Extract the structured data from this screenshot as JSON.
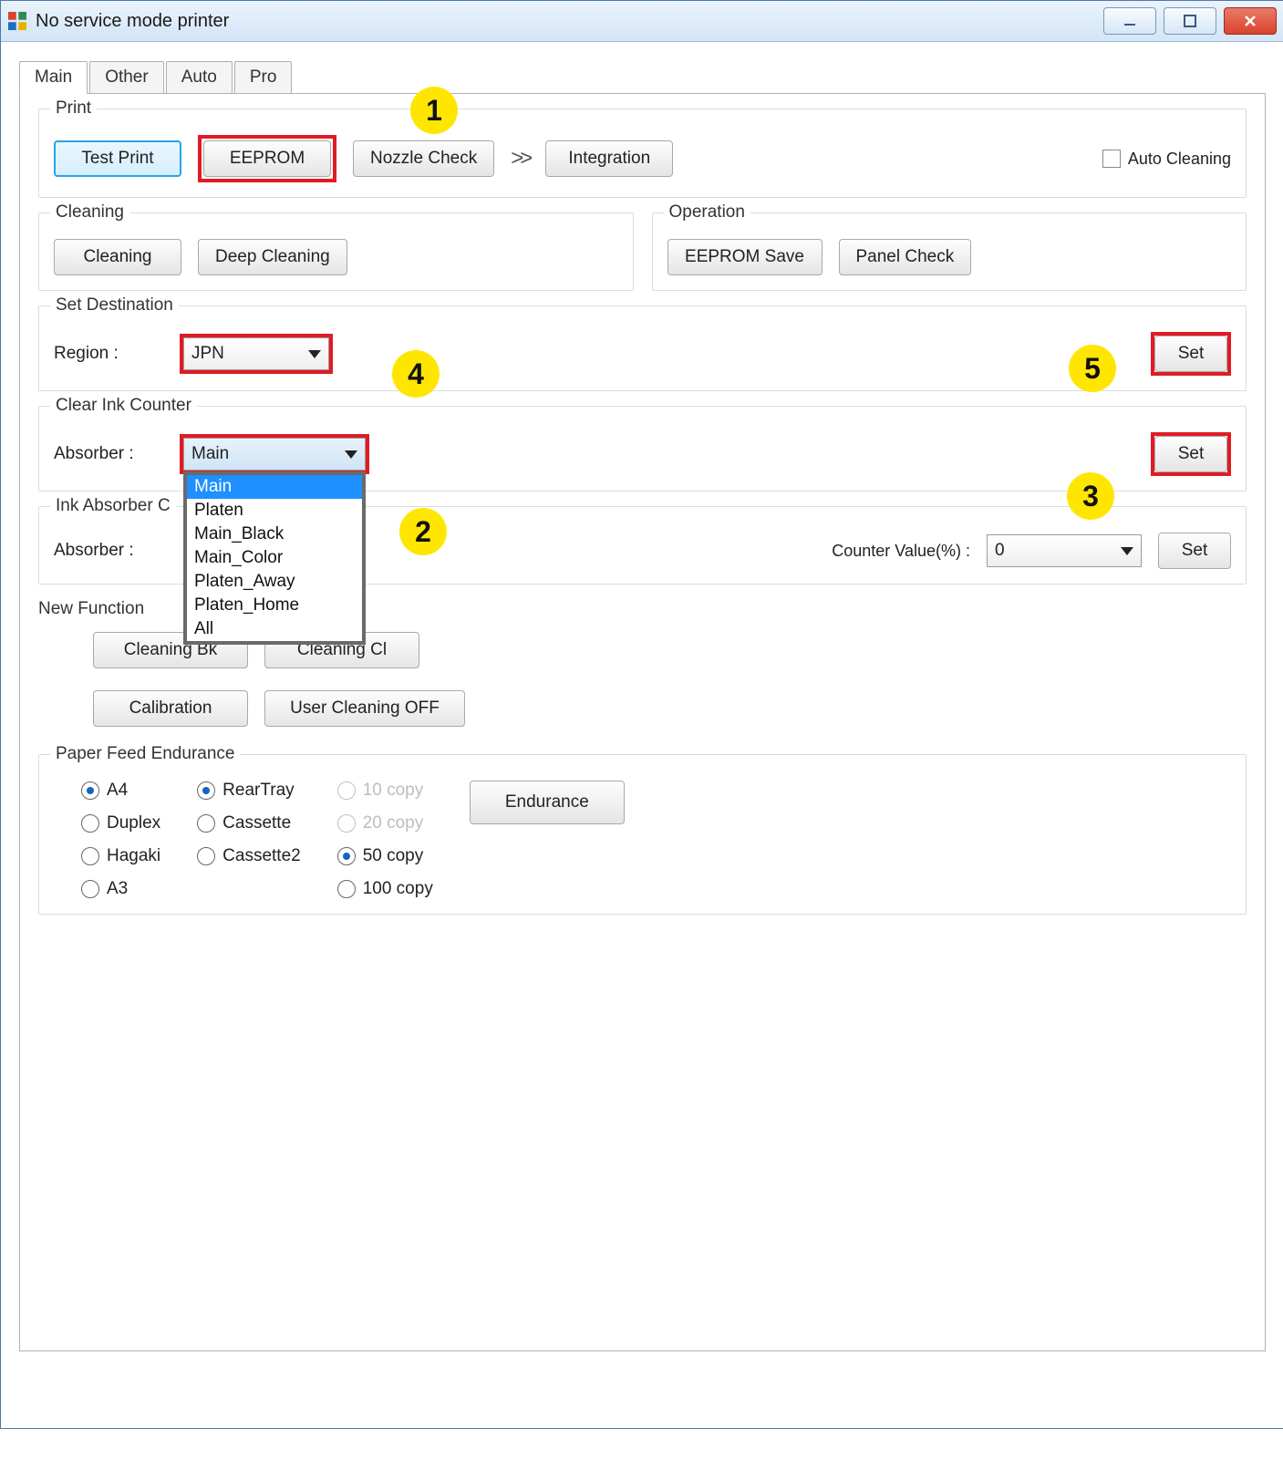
{
  "window": {
    "title": "No service mode printer"
  },
  "tabs": [
    "Main",
    "Other",
    "Auto",
    "Pro"
  ],
  "active_tab": 0,
  "print": {
    "title": "Print",
    "test_print": "Test Print",
    "eeprom": "EEPROM",
    "nozzle_check": "Nozzle Check",
    "arrow": ">>",
    "integration": "Integration",
    "auto_cleaning_label": "Auto Cleaning",
    "auto_cleaning_checked": false
  },
  "cleaning": {
    "title": "Cleaning",
    "cleaning": "Cleaning",
    "deep_cleaning": "Deep Cleaning"
  },
  "operation": {
    "title": "Operation",
    "eeprom_save": "EEPROM Save",
    "panel_check": "Panel Check"
  },
  "set_destination": {
    "title": "Set Destination",
    "region_label": "Region :",
    "region_value": "JPN",
    "set": "Set"
  },
  "clear_ink_counter": {
    "title": "Clear Ink Counter",
    "absorber_label": "Absorber :",
    "selected": "Main",
    "set": "Set",
    "options": [
      "Main",
      "Platen",
      "Main_Black",
      "Main_Color",
      "Platen_Away",
      "Platen_Home",
      "All"
    ]
  },
  "ink_absorber": {
    "title_partial": "Ink Absorber C",
    "absorber_label": "Absorber :",
    "counter_label": "Counter Value(%) :",
    "counter_value": "0",
    "set": "Set"
  },
  "new_function": {
    "title": "New Function",
    "cleaning_bk": "Cleaning Bk",
    "cleaning_cl": "Cleaning Cl",
    "calibration": "Calibration",
    "user_cleaning_off": "User Cleaning OFF"
  },
  "paper_feed": {
    "title": "Paper Feed Endurance",
    "size": {
      "A4": "A4",
      "Duplex": "Duplex",
      "Hagaki": "Hagaki",
      "A3": "A3"
    },
    "source": {
      "RearTray": "RearTray",
      "Cassette": "Cassette",
      "Cassette2": "Cassette2"
    },
    "copies": {
      "c10": "10 copy",
      "c20": "20 copy",
      "c50": "50 copy",
      "c100": "100 copy"
    },
    "endurance": "Endurance"
  },
  "callouts": {
    "1": "1",
    "2": "2",
    "3": "3",
    "4": "4",
    "5": "5"
  }
}
